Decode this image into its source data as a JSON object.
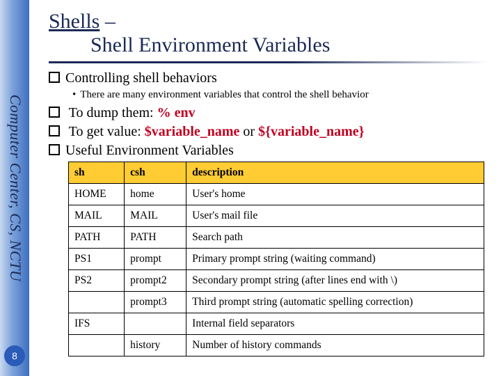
{
  "sidebar": {
    "text": "Computer Center, CS, NCTU"
  },
  "page_number": "8",
  "title": {
    "line1_underlined": "Shells",
    "line1_rest": " – ",
    "line2": "Shell Environment Variables"
  },
  "bullets": {
    "b1": "Controlling shell behaviors",
    "b1_sub": "There are many environment variables that control the shell behavior",
    "b2_pre": "To dump them: ",
    "b2_cmd": "% env",
    "b3_pre": "To get value: ",
    "b3_cmd1": "$variable_name",
    "b3_mid": " or ",
    "b3_cmd2": "${variable_name}",
    "b4": "Useful Environment Variables"
  },
  "table": {
    "headers": {
      "c1": "sh",
      "c2": "csh",
      "c3": "description"
    },
    "rows": [
      {
        "c1": "HOME",
        "c2": "home",
        "c3": "User's home"
      },
      {
        "c1": "MAIL",
        "c2": "MAIL",
        "c3": "User's mail file"
      },
      {
        "c1": "PATH",
        "c2": "PATH",
        "c3": "Search path"
      },
      {
        "c1": "PS1",
        "c2": "prompt",
        "c3": "Primary prompt string (waiting command)"
      },
      {
        "c1": "PS2",
        "c2": "prompt2",
        "c3": "Secondary prompt string (after lines end with \\)"
      },
      {
        "c1": "",
        "c2": "prompt3",
        "c3": "Third prompt string (automatic spelling correction)"
      },
      {
        "c1": "IFS",
        "c2": "",
        "c3": "Internal field separators"
      },
      {
        "c1": "",
        "c2": "history",
        "c3": "Number of history commands"
      }
    ]
  }
}
